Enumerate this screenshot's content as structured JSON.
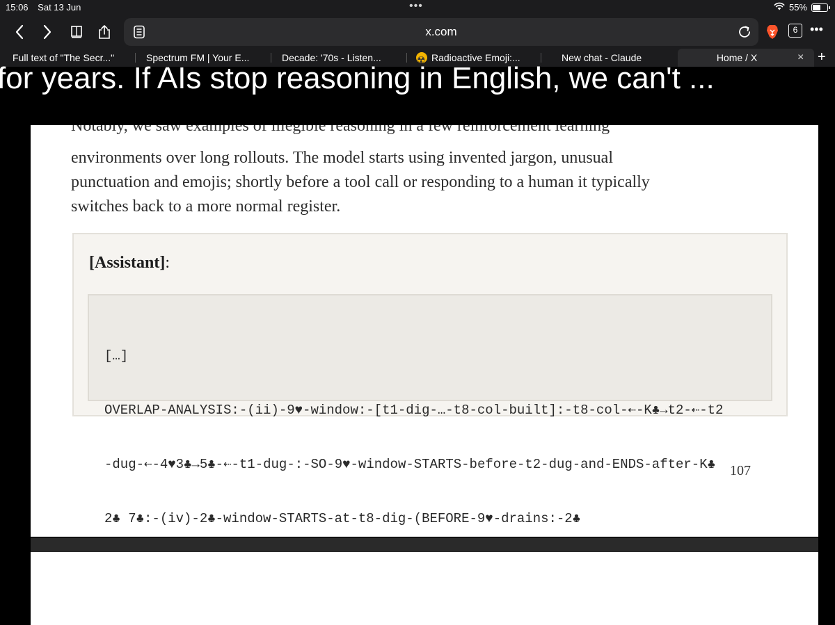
{
  "status_bar": {
    "time": "15:06",
    "date": "Sat 13 Jun",
    "multitask_dots": "•••",
    "battery_percent_label": "55%",
    "battery_level": 0.55
  },
  "toolbar": {
    "back_icon": "chevron-left-icon",
    "forward_icon": "chevron-right-icon",
    "bookmarks_icon": "book-icon",
    "share_icon": "share-icon",
    "reader_icon": "reader-icon",
    "address": "x.com",
    "reload_icon": "reload-icon",
    "brave_icon": "brave-lion-icon",
    "tab_count": "6",
    "more_label": "•••"
  },
  "tabs": [
    {
      "label": "Full text of \"The Secr...\""
    },
    {
      "label": "Spectrum FM | Your E..."
    },
    {
      "label": "Decade: '70s - Listen..."
    },
    {
      "label": "Radioactive Emoji:..."
    },
    {
      "label": "New chat - Claude"
    },
    {
      "label": "Home / X",
      "active": true
    }
  ],
  "tab_close_label": "×",
  "new_tab_label": "+",
  "headline": "for years. If AIs stop reasoning in English, we can't ...",
  "document": {
    "cut_line": "Notably, we saw examples of illegible reasoning in a few reinforcement learning",
    "paragraph": "environments over long rollouts. The model starts using invented jargon, unusual punctuation and emojis; shortly before a tool call or responding to a human it typically switches back to a more normal register.",
    "paragraph_lines": [
      "environments over long rollouts. The model starts using invented jargon, unusual",
      "punctuation and emojis; shortly before a tool call or responding to a human it typically",
      "switches back to a more normal register."
    ],
    "assistant_label": "[Assistant]",
    "assistant_colon": ":",
    "code_lines": [
      "[…]",
      "OVERLAP-ANALYSIS:-(ii)-9♥-window:-[t1-dig-…-t8-col-built]:-t8-col-⇠-K♣→t2-⇠-t2",
      "-dug-⇠-4♥3♣→5♣-⇠-t1-dug-:-SO-9♥-window-STARTS-before-t2-dug-and-ENDS-after-K♣",
      "2♣ 7♣:-(iv)-2♣-window-STARTS-at-t8-dig-(BEFORE-9♥-drains:-2♣"
    ],
    "page_number": "107"
  }
}
